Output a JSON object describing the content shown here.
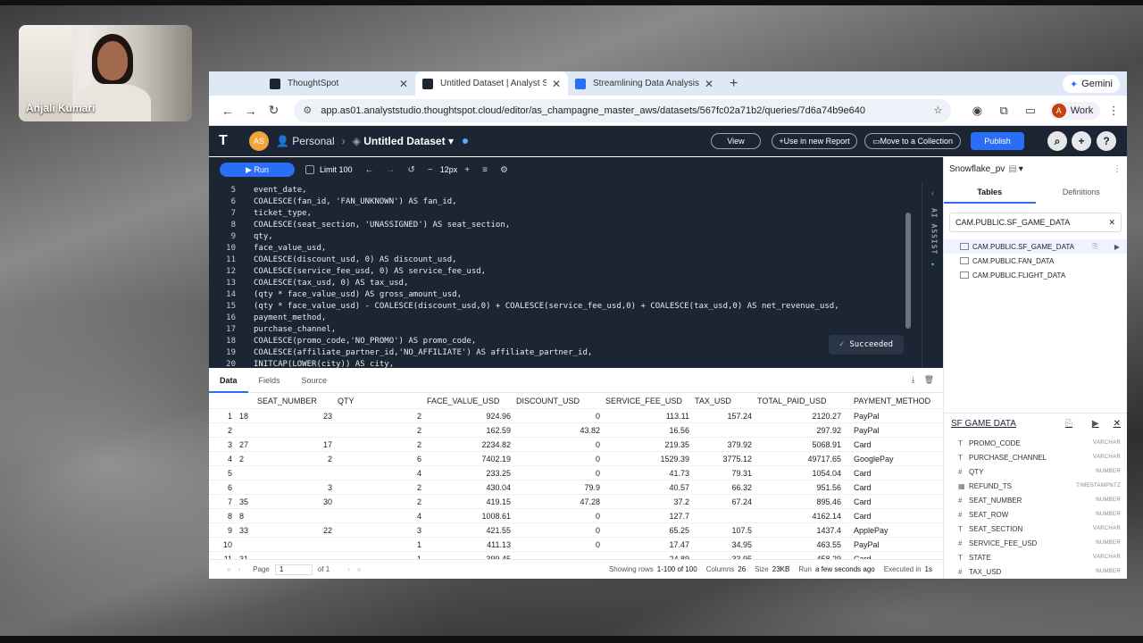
{
  "webcam": {
    "name": "Anjali Kumari"
  },
  "browser": {
    "tabs": [
      {
        "title": "ThoughtSpot",
        "color": "#1b2533"
      },
      {
        "title": "Untitled Dataset | Analyst Stu",
        "color": "#1b2533"
      },
      {
        "title": "Streamlining Data Analysis fo",
        "color": "#2a6ef5"
      }
    ],
    "new_tab": "+",
    "gemini": "Gemini",
    "url": "app.as01.analyststudio.thoughtspot.cloud/editor/as_champagne_master_aws/datasets/567fc02a71b2/queries/7d6a74b9e640",
    "profile": {
      "initial": "A",
      "label": "Work"
    }
  },
  "app": {
    "avatar": "AS",
    "workspace": "Personal",
    "dataset_title": "Untitled Dataset",
    "buttons": {
      "view": "View",
      "use_in_report": "Use in new Report",
      "move": "Move to a Collection",
      "publish": "Publish"
    }
  },
  "toolbar": {
    "run": "Run",
    "limit": "Limit 100",
    "font_size": "12px"
  },
  "editor": {
    "lines": [
      {
        "n": "5",
        "code": "event_date,"
      },
      {
        "n": "6",
        "code": "COALESCE(fan_id, 'FAN_UNKNOWN') AS fan_id,"
      },
      {
        "n": "7",
        "code": "ticket_type,"
      },
      {
        "n": "8",
        "code": "COALESCE(seat_section, 'UNASSIGNED') AS seat_section,"
      },
      {
        "n": "9",
        "code": "qty,"
      },
      {
        "n": "10",
        "code": "face_value_usd,"
      },
      {
        "n": "11",
        "code": "COALESCE(discount_usd, 0) AS discount_usd,"
      },
      {
        "n": "12",
        "code": "COALESCE(service_fee_usd, 0) AS service_fee_usd,"
      },
      {
        "n": "13",
        "code": "COALESCE(tax_usd, 0) AS tax_usd,"
      },
      {
        "n": "14",
        "code": "(qty * face_value_usd) AS gross_amount_usd,"
      },
      {
        "n": "15",
        "code": "(qty * face_value_usd) - COALESCE(discount_usd,0) + COALESCE(service_fee_usd,0) + COALESCE(tax_usd,0) AS net_revenue_usd,"
      },
      {
        "n": "16",
        "code": "payment_method,"
      },
      {
        "n": "17",
        "code": "purchase_channel,"
      },
      {
        "n": "18",
        "code": "COALESCE(promo_code,'NO_PROMO') AS promo_code,"
      },
      {
        "n": "19",
        "code": "COALESCE(affiliate_partner_id,'NO_AFFILIATE') AS affiliate_partner_id,"
      },
      {
        "n": "20",
        "code": "INITCAP(LOWER(city)) AS city,"
      }
    ],
    "status": "Succeeded",
    "ai_assist": "AI ASSIST"
  },
  "results": {
    "tabs": [
      "Data",
      "Fields",
      "Source"
    ],
    "columns": [
      "SEAT_NUMBER",
      "QTY",
      "FACE_VALUE_USD",
      "DISCOUNT_USD",
      "SERVICE_FEE_USD",
      "TAX_USD",
      "TOTAL_PAID_USD",
      "PAYMENT_METHOD"
    ],
    "rows": [
      [
        "1",
        "18",
        "23",
        "2",
        "924.96",
        "0",
        "113.11",
        "157.24",
        "2120.27",
        "PayPal"
      ],
      [
        "2",
        "",
        "",
        "2",
        "162.59",
        "43.82",
        "16.56",
        "",
        "297.92",
        "PayPal"
      ],
      [
        "3",
        "27",
        "17",
        "2",
        "2234.82",
        "0",
        "219.35",
        "379.92",
        "5068.91",
        "Card"
      ],
      [
        "4",
        "2",
        "2",
        "6",
        "7402.19",
        "0",
        "1529.39",
        "3775.12",
        "49717.65",
        "GooglePay"
      ],
      [
        "5",
        "",
        "",
        "4",
        "233.25",
        "0",
        "41.73",
        "79.31",
        "1054.04",
        "Card"
      ],
      [
        "6",
        "",
        "3",
        "2",
        "430.04",
        "79.9",
        "40.57",
        "66.32",
        "951.56",
        "Card"
      ],
      [
        "7",
        "35",
        "30",
        "2",
        "419.15",
        "47.28",
        "37.2",
        "67.24",
        "895.46",
        "Card"
      ],
      [
        "8",
        "8",
        "",
        "4",
        "1008.61",
        "0",
        "127.7",
        "",
        "4162.14",
        "Card"
      ],
      [
        "9",
        "33",
        "22",
        "3",
        "421.55",
        "0",
        "65.25",
        "107.5",
        "1437.4",
        "ApplePay"
      ],
      [
        "10",
        "",
        "",
        "1",
        "411.13",
        "0",
        "17.47",
        "34.95",
        "463.55",
        "PayPal"
      ],
      [
        "11",
        "31",
        "",
        "1",
        "399.45",
        "",
        "24.89",
        "33.95",
        "458.29",
        "Card"
      ]
    ],
    "footer": {
      "page_label": "Page",
      "page": "1",
      "of": "of 1",
      "showing_label": "Showing rows",
      "showing": "1-100 of 100",
      "columns_label": "Columns",
      "columns": "26",
      "size_label": "Size",
      "size": "23KB",
      "run_label": "Run",
      "run": "a few seconds ago",
      "exec_label": "Executed in",
      "exec": "1s"
    }
  },
  "sidebar": {
    "connection": "Snowflake_pv",
    "tabs": [
      "Tables",
      "Definitions"
    ],
    "search": "CAM.PUBLIC.SF_GAME_DATA",
    "tables": [
      "CAM.PUBLIC.SF_GAME_DATA",
      "CAM.PUBLIC.FAN_DATA",
      "CAM.PUBLIC.FLIGHT_DATA"
    ],
    "schema_title": "SF GAME DATA",
    "fields": [
      {
        "sym": "T",
        "name": "PROMO_CODE",
        "type": "VARCHAR"
      },
      {
        "sym": "T",
        "name": "PURCHASE_CHANNEL",
        "type": "VARCHAR"
      },
      {
        "sym": "#",
        "name": "QTY",
        "type": "NUMBER"
      },
      {
        "sym": "▦",
        "name": "REFUND_TS",
        "type": "TIMESTAMPNTZ"
      },
      {
        "sym": "#",
        "name": "SEAT_NUMBER",
        "type": "NUMBER"
      },
      {
        "sym": "#",
        "name": "SEAT_ROW",
        "type": "NUMBER"
      },
      {
        "sym": "T",
        "name": "SEAT_SECTION",
        "type": "VARCHAR"
      },
      {
        "sym": "#",
        "name": "SERVICE_FEE_USD",
        "type": "NUMBER"
      },
      {
        "sym": "T",
        "name": "STATE",
        "type": "VARCHAR"
      },
      {
        "sym": "#",
        "name": "TAX_USD",
        "type": "NUMBER"
      }
    ]
  }
}
